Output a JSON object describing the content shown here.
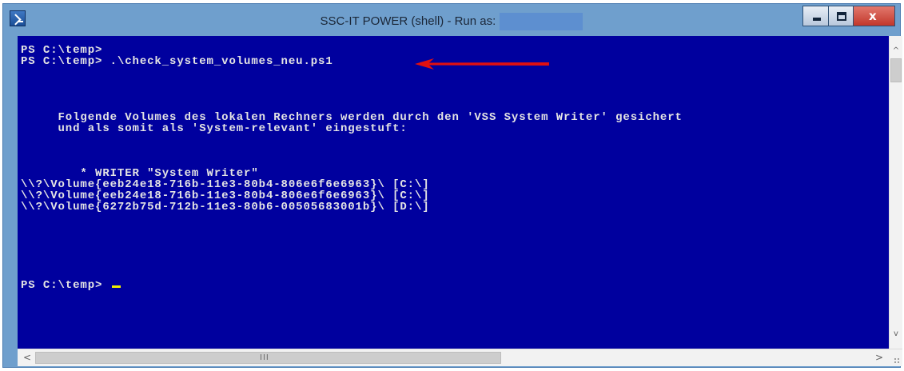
{
  "window": {
    "title": "SSC-IT POWER (shell) - Run as:",
    "close_glyph": "x"
  },
  "console": {
    "lines": [
      "PS C:\\temp>",
      "PS C:\\temp> .\\check_system_volumes_neu.ps1",
      "     Folgende Volumes des lokalen Rechners werden durch den 'VSS System Writer' gesichert",
      "     und als somit als 'System-relevant' eingestuft:",
      "        * WRITER \"System Writer\"",
      "\\\\?\\Volume{eeb24e18-716b-11e3-80b4-806e6f6e6963}\\ [C:\\]",
      "\\\\?\\Volume{eeb24e18-716b-11e3-80b4-806e6f6e6963}\\ [C:\\]",
      "\\\\?\\Volume{6272b75d-712b-11e3-80b6-00505683001b}\\ [D:\\]",
      "PS C:\\temp> "
    ]
  },
  "scrollbar": {
    "up_glyph": "^",
    "down_glyph": "v",
    "left_glyph": "<",
    "right_glyph": ">",
    "grip_glyph": "III"
  },
  "colors": {
    "console_bg": "#00009e",
    "console_fg": "#e4e4e4",
    "cursor": "#f0f000",
    "arrow": "#e01010"
  }
}
